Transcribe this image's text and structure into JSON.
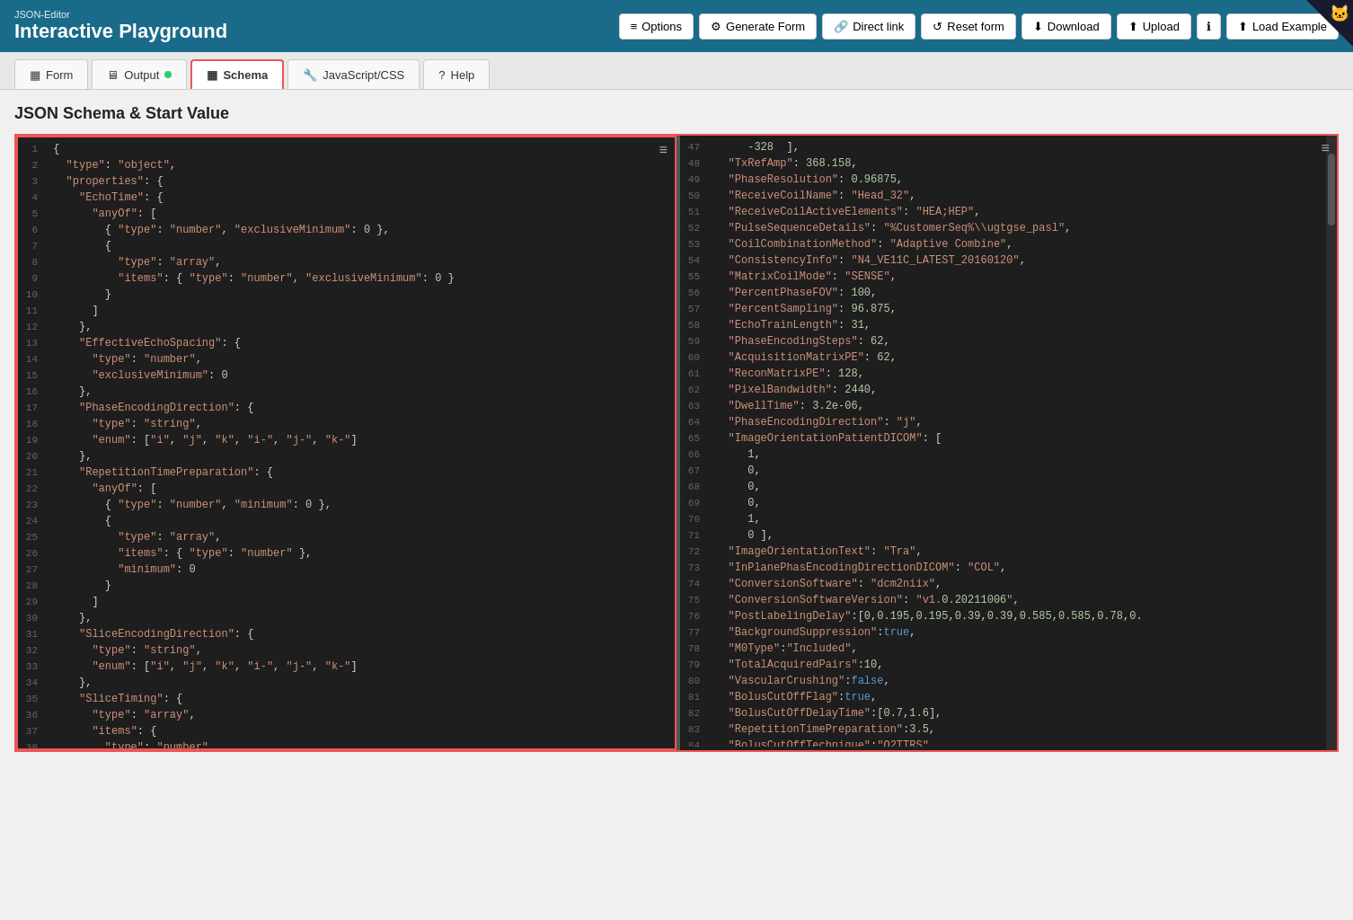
{
  "header": {
    "subtitle": "JSON-Editor",
    "title": "Interactive Playground",
    "buttons": [
      {
        "label": "Options",
        "icon": "≡",
        "name": "options-button"
      },
      {
        "label": "Generate Form",
        "icon": "⚙",
        "name": "generate-form-button"
      },
      {
        "label": "Direct link",
        "icon": "🔗",
        "name": "direct-link-button"
      },
      {
        "label": "Reset form",
        "icon": "↺",
        "name": "reset-form-button"
      },
      {
        "label": "Download",
        "icon": "⬇",
        "name": "download-button"
      },
      {
        "label": "Upload",
        "icon": "⬆",
        "name": "upload-button"
      },
      {
        "label": "ℹ",
        "icon": "",
        "name": "info-button"
      },
      {
        "label": "Load Example",
        "icon": "⬆",
        "name": "load-example-button"
      }
    ]
  },
  "tabs": [
    {
      "label": "Form",
      "icon": "▦",
      "name": "tab-form",
      "active": false,
      "has_dot": false
    },
    {
      "label": "Output",
      "icon": "🖥",
      "name": "tab-output",
      "active": false,
      "has_dot": true
    },
    {
      "label": "Schema",
      "icon": "▦",
      "name": "tab-schema",
      "active": true,
      "has_dot": false
    },
    {
      "label": "JavaScript/CSS",
      "icon": "🔧",
      "name": "tab-javascript-css",
      "active": false,
      "has_dot": false
    },
    {
      "label": "Help",
      "icon": "?",
      "name": "tab-help",
      "active": false,
      "has_dot": false
    }
  ],
  "section_title": "JSON Schema & Start Value",
  "left_editor": {
    "lines": [
      {
        "num": "1",
        "content": " {"
      },
      {
        "num": "2",
        "content": "   \"type\": \"object\","
      },
      {
        "num": "3",
        "content": "   \"properties\": {"
      },
      {
        "num": "4",
        "content": "     \"EchoTime\": {"
      },
      {
        "num": "5",
        "content": "       \"anyOf\": ["
      },
      {
        "num": "6",
        "content": "         { \"type\": \"number\", \"exclusiveMinimum\": 0 },"
      },
      {
        "num": "7",
        "content": "         {"
      },
      {
        "num": "8",
        "content": "           \"type\": \"array\","
      },
      {
        "num": "9",
        "content": "           \"items\": { \"type\": \"number\", \"exclusiveMinimum\": 0 }"
      },
      {
        "num": "10",
        "content": "         }"
      },
      {
        "num": "11",
        "content": "       ]"
      },
      {
        "num": "12",
        "content": "     },"
      },
      {
        "num": "13",
        "content": "     \"EffectiveEchoSpacing\": {"
      },
      {
        "num": "14",
        "content": "       \"type\": \"number\","
      },
      {
        "num": "15",
        "content": "       \"exclusiveMinimum\": 0"
      },
      {
        "num": "16",
        "content": "     },"
      },
      {
        "num": "17",
        "content": "     \"PhaseEncodingDirection\": {"
      },
      {
        "num": "18",
        "content": "       \"type\": \"string\","
      },
      {
        "num": "19",
        "content": "       \"enum\": [\"i\", \"j\", \"k\", \"i-\", \"j-\", \"k-\"]"
      },
      {
        "num": "20",
        "content": "     },"
      },
      {
        "num": "21",
        "content": "     \"RepetitionTimePreparation\": {"
      },
      {
        "num": "22",
        "content": "       \"anyOf\": ["
      },
      {
        "num": "23",
        "content": "         { \"type\": \"number\", \"minimum\": 0 },"
      },
      {
        "num": "24",
        "content": "         {"
      },
      {
        "num": "25",
        "content": "           \"type\": \"array\","
      },
      {
        "num": "26",
        "content": "           \"items\": { \"type\": \"number\" },"
      },
      {
        "num": "27",
        "content": "           \"minimum\": 0"
      },
      {
        "num": "28",
        "content": "         }"
      },
      {
        "num": "29",
        "content": "       ]"
      },
      {
        "num": "30",
        "content": "     },"
      },
      {
        "num": "31",
        "content": "     \"SliceEncodingDirection\": {"
      },
      {
        "num": "32",
        "content": "       \"type\": \"string\","
      },
      {
        "num": "33",
        "content": "       \"enum\": [\"i\", \"j\", \"k\", \"i-\", \"j-\", \"k-\"]"
      },
      {
        "num": "34",
        "content": "     },"
      },
      {
        "num": "35",
        "content": "     \"SliceTiming\": {"
      },
      {
        "num": "36",
        "content": "       \"type\": \"array\","
      },
      {
        "num": "37",
        "content": "       \"items\": {"
      },
      {
        "num": "38",
        "content": "         \"type\": \"number\""
      }
    ]
  },
  "right_editor": {
    "lines": [
      {
        "num": "47",
        "content": "      -328  ],"
      },
      {
        "num": "48",
        "content": "   \"TxRefAmp\": 368.158,"
      },
      {
        "num": "49",
        "content": "   \"PhaseResolution\": 0.96875,"
      },
      {
        "num": "50",
        "content": "   \"ReceiveCoilName\": \"Head_32\","
      },
      {
        "num": "51",
        "content": "   \"ReceiveCoilActiveElements\": \"HEA;HEP\","
      },
      {
        "num": "52",
        "content": "   \"PulseSequenceDetails\": \"%CustomerSeq%\\\\ugtgse_pasl\","
      },
      {
        "num": "53",
        "content": "   \"CoilCombinationMethod\": \"Adaptive Combine\","
      },
      {
        "num": "54",
        "content": "   \"ConsistencyInfo\": \"N4_VE11C_LATEST_20160120\","
      },
      {
        "num": "55",
        "content": "   \"MatrixCoilMode\": \"SENSE\","
      },
      {
        "num": "56",
        "content": "   \"PercentPhaseFOV\": 100,"
      },
      {
        "num": "57",
        "content": "   \"PercentSampling\": 96.875,"
      },
      {
        "num": "58",
        "content": "   \"EchoTrainLength\": 31,"
      },
      {
        "num": "59",
        "content": "   \"PhaseEncodingSteps\": 62,"
      },
      {
        "num": "60",
        "content": "   \"AcquisitionMatrixPE\": 62,"
      },
      {
        "num": "61",
        "content": "   \"ReconMatrixPE\": 128,"
      },
      {
        "num": "62",
        "content": "   \"PixelBandwidth\": 2440,"
      },
      {
        "num": "63",
        "content": "   \"DwellTime\": 3.2e-06,"
      },
      {
        "num": "64",
        "content": "   \"PhaseEncodingDirection\": \"j\","
      },
      {
        "num": "65",
        "content": "   \"ImageOrientationPatientDICOM\": ["
      },
      {
        "num": "66",
        "content": "      1,"
      },
      {
        "num": "67",
        "content": "      0,"
      },
      {
        "num": "68",
        "content": "      0,"
      },
      {
        "num": "69",
        "content": "      0,"
      },
      {
        "num": "70",
        "content": "      1,"
      },
      {
        "num": "71",
        "content": "      0 ],"
      },
      {
        "num": "72",
        "content": "   \"ImageOrientationText\": \"Tra\","
      },
      {
        "num": "73",
        "content": "   \"InPlanePhasEncodingDirectionDICOM\": \"COL\","
      },
      {
        "num": "74",
        "content": "   \"ConversionSoftware\": \"dcm2niix\","
      },
      {
        "num": "75",
        "content": "   \"ConversionSoftwareVersion\": \"v1.0.20211006\","
      },
      {
        "num": "76",
        "content": "   \"PostLabelingDelay\":[0,0.195,0.195,0.39,0.39,0.585,0.585,0.78,0."
      },
      {
        "num": "77",
        "content": "   \"BackgroundSuppression\":true,"
      },
      {
        "num": "78",
        "content": "   \"M0Type\":\"Included\","
      },
      {
        "num": "79",
        "content": "   \"TotalAcquiredPairs\":10,"
      },
      {
        "num": "80",
        "content": "   \"VascularCrushing\":false,"
      },
      {
        "num": "81",
        "content": "   \"BolusCutOffFlag\":true,"
      },
      {
        "num": "82",
        "content": "   \"BolusCutOffDelayTime\":[0.7,1.6],"
      },
      {
        "num": "83",
        "content": "   \"RepetitionTimePreparation\":3.5,"
      },
      {
        "num": "84",
        "content": "   \"BolusCutOffTechnique\":\"Q2TTRS\""
      }
    ]
  }
}
